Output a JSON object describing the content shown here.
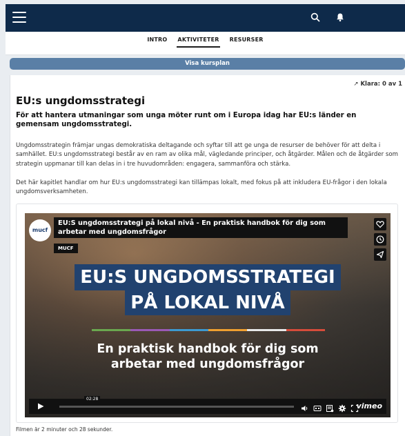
{
  "nav": {
    "menu_icon": "hamburger-menu-icon",
    "search_icon": "search-icon",
    "bell_icon": "bell-icon",
    "bg_color": "#0e2a4a"
  },
  "tabs": [
    {
      "label": "INTRO",
      "active": false
    },
    {
      "label": "AKTIVITETER",
      "active": true
    },
    {
      "label": "RESURSER",
      "active": false
    }
  ],
  "kursplan_button": {
    "label": "Visa kursplan",
    "color": "#5a7fa6"
  },
  "progress": {
    "label": "Klara: 0 av 1",
    "icon": "trending-up-icon"
  },
  "article": {
    "title": "EU:s ungdomsstrategi",
    "lead": "För att hantera utmaningar som unga möter runt om i Europa idag har EU:s länder en gemensam ungdomsstrategi.",
    "paragraph1": "Ungdomsstrategin främjar ungas demokratiska deltagande och syftar till att ge unga de resurser de behöver för att delta i samhället. EU:s ungdomsstrategi består av en ram av olika mål, vägledande principer, och åtgärder. Målen och de åtgärder som strategin uppmanar till kan delas in i tre huvudområden: engagera, sammanföra och stärka.",
    "paragraph2": "Det här kapitlet handlar om hur EU:s ungdomsstrategi kan tillämpas lokalt, med fokus på att inkludera EU-frågor i den lokala ungdomsverksamheten."
  },
  "video": {
    "logo_text": "mucf",
    "title": "EU:S ungdomsstrategi på lokal nivå - En praktisk handbok för dig som arbetar med ungdomsfrågor",
    "channel": "MUCF",
    "headline_line1": "EU:S UNGDOMSSTRATEGI",
    "headline_line2": "PÅ LOKAL NIVÅ",
    "subtitle_line1": "En praktisk handbok för dig som",
    "subtitle_line2": "arbetar med ungdomsfrågor",
    "duration": "02:28",
    "brand": "vimeo",
    "side_icons": [
      "heart-icon",
      "clock-icon",
      "send-icon"
    ],
    "control_icons": [
      "play-icon",
      "volume-icon",
      "captions-icon",
      "transcript-icon",
      "settings-icon",
      "fullscreen-icon"
    ],
    "stripe_colors": [
      "#6aa84f",
      "#9b59b6",
      "#3d9ad1",
      "#f0a030",
      "#e8e8e8",
      "#d64c3b"
    ]
  },
  "caption": "Filmen är 2 minuter och 28 sekunder."
}
